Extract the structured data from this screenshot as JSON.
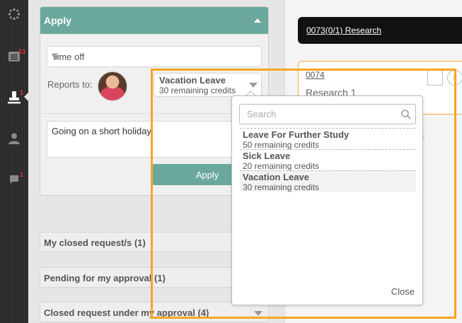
{
  "rail": {
    "badges": {
      "requests": "13",
      "approvals": "1",
      "messages": "1"
    }
  },
  "apply": {
    "title": "Apply",
    "type_value": "Time off",
    "reports_to_label": "Reports to:",
    "leave_type": "Vacation Leave",
    "leave_credits": "30 remaining credits",
    "notes_value": "Going on a short holiday",
    "apply_button": "Apply"
  },
  "accordions": [
    "My closed request/s (1)",
    "Pending for my approval (1)",
    "Closed request under my approval (4)"
  ],
  "right": {
    "bar_label": "0073(0/1) Research",
    "item_id": "0074",
    "item_name": "Research 1",
    "faded_text": "re"
  },
  "dropdown": {
    "search_placeholder": "Search",
    "options": [
      {
        "name": "Leave For Further Study",
        "credits": "50 remaining credits"
      },
      {
        "name": "Sick Leave",
        "credits": "20 remaining credits"
      },
      {
        "name": "Vacation Leave",
        "credits": "30 remaining credits"
      }
    ],
    "close_label": "Close"
  },
  "colors": {
    "accent": "#6aa89d",
    "highlight": "#f5a623",
    "rail": "#2e2e2e"
  }
}
